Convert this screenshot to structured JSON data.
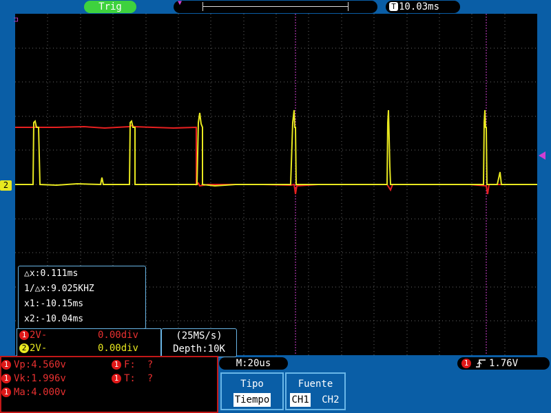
{
  "top": {
    "trig_label": "Trig",
    "time_position": "10.03ms"
  },
  "channel_marker": "2",
  "cursors": {
    "dx": "△x:0.111ms",
    "inv_dx": "1/△x:9.025KHZ",
    "x1": "x1:-10.15ms",
    "x2": "x2:-10.04ms"
  },
  "channels": [
    {
      "id": "1",
      "scale": "2V-",
      "offset": "0.00div",
      "color": "#e83030"
    },
    {
      "id": "2",
      "scale": "2V-",
      "offset": "0.00div",
      "color": "#e8e820"
    }
  ],
  "acquisition": {
    "rate": "(25MS/s)",
    "depth": "Depth:10K"
  },
  "measurements": {
    "vp": "Vp:4.560v",
    "vk": "Vk:1.996v",
    "ma": "Ma:4.000v",
    "f": "F:  ?",
    "t": "T:  ?"
  },
  "timebase": "M:20us",
  "trigger": {
    "channel": "1",
    "edge": "⎍",
    "level": "1.76V"
  },
  "menu": {
    "tipo": {
      "title": "Tipo",
      "options": [
        "Tiempo"
      ]
    },
    "fuente": {
      "title": "Fuente",
      "options": [
        "CH1",
        "CH2"
      ],
      "selected": "CH1"
    }
  },
  "colors": {
    "ch1": "#e83030",
    "ch2": "#e8e820",
    "cursor": "#d23fd2",
    "accent": "#0a5ea6"
  }
}
